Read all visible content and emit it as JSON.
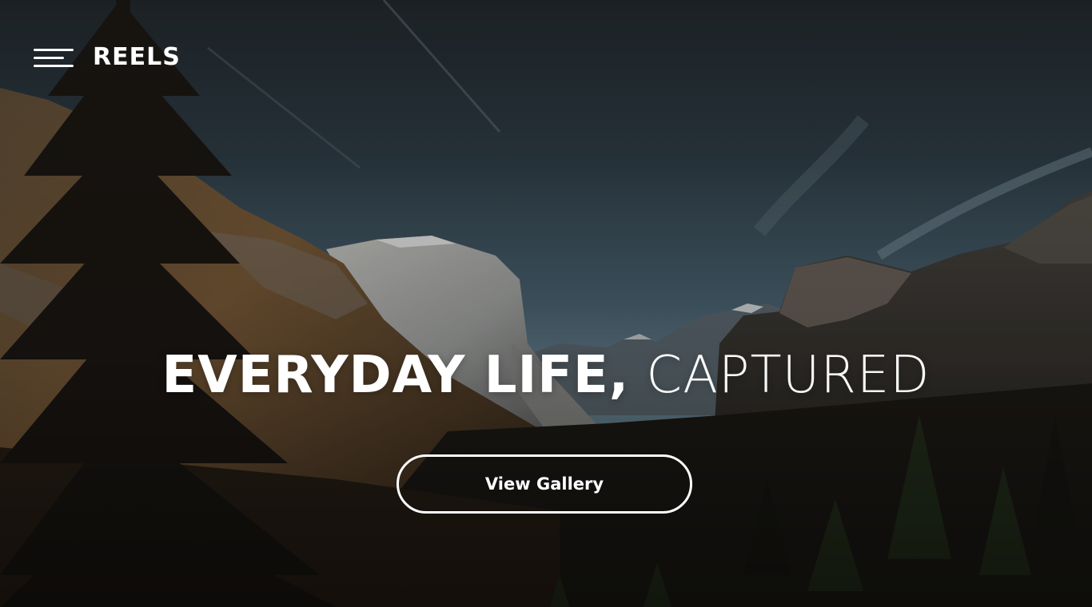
{
  "header": {
    "menu_icon": "hamburger-menu-icon",
    "logo": "REELS"
  },
  "hero": {
    "title_bold": "EVERYDAY LIFE,",
    "title_light": "CAPTURED",
    "cta_label": "View Gallery"
  },
  "background": {
    "description_icon": "mountain-valley-photo",
    "sky_top": "#20262b",
    "sky_bottom": "#5d7989",
    "forest": "#1f1a14"
  },
  "colors": {
    "text": "#ffffff",
    "button_border": "#ffffff"
  }
}
